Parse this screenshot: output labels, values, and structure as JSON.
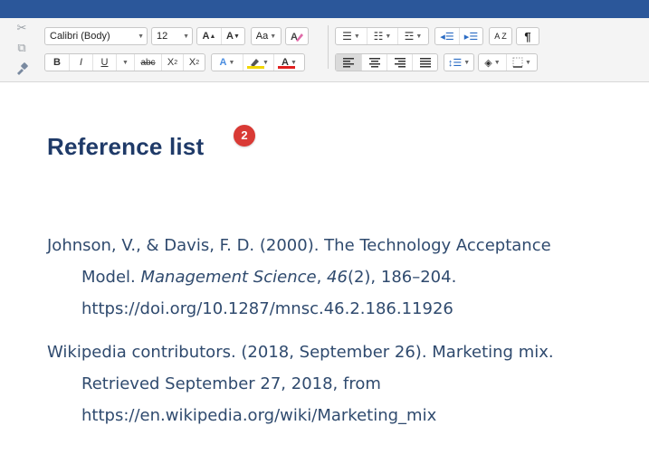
{
  "toolbar": {
    "font_name": "Calibri (Body)",
    "font_size": "12",
    "grow_font": "A",
    "shrink_font": "A",
    "change_case": "Aa",
    "bold": "B",
    "italic": "I",
    "underline": "U",
    "strikethrough": "abc",
    "subscript_base": "X",
    "subscript_mark": "2",
    "superscript_base": "X",
    "superscript_mark": "2",
    "text_effects": "A",
    "font_color": "A",
    "sort": "A Z",
    "show_formatting": "¶",
    "colors": {
      "highlight": "#f2d600",
      "font_color": "#e02020",
      "effects": "#4a8de0"
    }
  },
  "document": {
    "heading": "Reference list",
    "badge": "2",
    "references": [
      {
        "line1": "Johnson, V., & Davis, F. D. (2000). The Technology Acceptance",
        "line2_pre": "Model. ",
        "line2_journal": "Management Science",
        "line2_mid": ", ",
        "line2_volume": "46",
        "line2_post": "(2), 186–204.",
        "line3": "https://doi.org/10.1287/mnsc.46.2.186.11926"
      },
      {
        "line1": "Wikipedia contributors. (2018, September 26). Marketing mix.",
        "line2": "Retrieved September 27, 2018, from",
        "line3": "https://en.wikipedia.org/wiki/Marketing_mix"
      }
    ]
  }
}
